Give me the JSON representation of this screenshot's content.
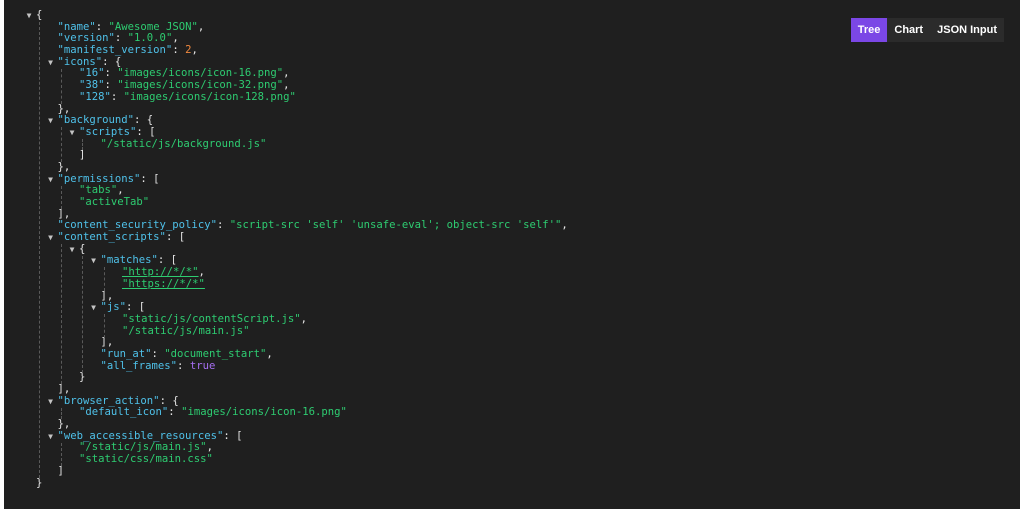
{
  "tabs": [
    {
      "label": "Tree",
      "active": true
    },
    {
      "label": "Chart",
      "active": false
    },
    {
      "label": "JSON Input",
      "active": false
    }
  ],
  "lines": [
    {
      "d": 0,
      "t": "o",
      "parts": [
        {
          "c": "p",
          "x": "{"
        }
      ]
    },
    {
      "d": 1,
      "parts": [
        {
          "c": "k",
          "x": "\"name\""
        },
        {
          "c": "p",
          "x": ": "
        },
        {
          "c": "s",
          "x": "\"Awesome JSON\""
        },
        {
          "c": "p",
          "x": ","
        }
      ]
    },
    {
      "d": 1,
      "parts": [
        {
          "c": "k",
          "x": "\"version\""
        },
        {
          "c": "p",
          "x": ": "
        },
        {
          "c": "s",
          "x": "\"1.0.0\""
        },
        {
          "c": "p",
          "x": ","
        }
      ]
    },
    {
      "d": 1,
      "parts": [
        {
          "c": "k",
          "x": "\"manifest_version\""
        },
        {
          "c": "p",
          "x": ": "
        },
        {
          "c": "n",
          "x": "2"
        },
        {
          "c": "p",
          "x": ","
        }
      ]
    },
    {
      "d": 1,
      "t": "o",
      "parts": [
        {
          "c": "k",
          "x": "\"icons\""
        },
        {
          "c": "p",
          "x": ": {"
        }
      ]
    },
    {
      "d": 2,
      "parts": [
        {
          "c": "k",
          "x": "\"16\""
        },
        {
          "c": "p",
          "x": ": "
        },
        {
          "c": "s",
          "x": "\"images/icons/icon-16.png\""
        },
        {
          "c": "p",
          "x": ","
        }
      ]
    },
    {
      "d": 2,
      "parts": [
        {
          "c": "k",
          "x": "\"38\""
        },
        {
          "c": "p",
          "x": ": "
        },
        {
          "c": "s",
          "x": "\"images/icons/icon-32.png\""
        },
        {
          "c": "p",
          "x": ","
        }
      ]
    },
    {
      "d": 2,
      "parts": [
        {
          "c": "k",
          "x": "\"128\""
        },
        {
          "c": "p",
          "x": ": "
        },
        {
          "c": "s",
          "x": "\"images/icons/icon-128.png\""
        }
      ]
    },
    {
      "d": 1,
      "parts": [
        {
          "c": "p",
          "x": "},"
        }
      ]
    },
    {
      "d": 1,
      "t": "o",
      "parts": [
        {
          "c": "k",
          "x": "\"background\""
        },
        {
          "c": "p",
          "x": ": {"
        }
      ]
    },
    {
      "d": 2,
      "t": "o",
      "parts": [
        {
          "c": "k",
          "x": "\"scripts\""
        },
        {
          "c": "p",
          "x": ": ["
        }
      ]
    },
    {
      "d": 3,
      "parts": [
        {
          "c": "s",
          "x": "\"/static/js/background.js\""
        }
      ]
    },
    {
      "d": 2,
      "parts": [
        {
          "c": "p",
          "x": "]"
        }
      ]
    },
    {
      "d": 1,
      "parts": [
        {
          "c": "p",
          "x": "},"
        }
      ]
    },
    {
      "d": 1,
      "t": "o",
      "parts": [
        {
          "c": "k",
          "x": "\"permissions\""
        },
        {
          "c": "p",
          "x": ": ["
        }
      ]
    },
    {
      "d": 2,
      "parts": [
        {
          "c": "s",
          "x": "\"tabs\""
        },
        {
          "c": "p",
          "x": ","
        }
      ]
    },
    {
      "d": 2,
      "parts": [
        {
          "c": "s",
          "x": "\"activeTab\""
        }
      ]
    },
    {
      "d": 1,
      "parts": [
        {
          "c": "p",
          "x": "],"
        }
      ]
    },
    {
      "d": 1,
      "parts": [
        {
          "c": "k",
          "x": "\"content_security_policy\""
        },
        {
          "c": "p",
          "x": ": "
        },
        {
          "c": "s",
          "x": "\"script-src 'self' 'unsafe-eval'; object-src 'self'\""
        },
        {
          "c": "p",
          "x": ","
        }
      ]
    },
    {
      "d": 1,
      "t": "o",
      "parts": [
        {
          "c": "k",
          "x": "\"content_scripts\""
        },
        {
          "c": "p",
          "x": ": ["
        }
      ]
    },
    {
      "d": 2,
      "t": "o",
      "parts": [
        {
          "c": "p",
          "x": "{"
        }
      ]
    },
    {
      "d": 3,
      "t": "o",
      "parts": [
        {
          "c": "k",
          "x": "\"matches\""
        },
        {
          "c": "p",
          "x": ": ["
        }
      ]
    },
    {
      "d": 4,
      "parts": [
        {
          "c": "u",
          "x": "\"http://*/*\""
        },
        {
          "c": "p",
          "x": ","
        }
      ]
    },
    {
      "d": 4,
      "parts": [
        {
          "c": "u",
          "x": "\"https://*/*\""
        }
      ]
    },
    {
      "d": 3,
      "parts": [
        {
          "c": "p",
          "x": "],"
        }
      ]
    },
    {
      "d": 3,
      "t": "o",
      "parts": [
        {
          "c": "k",
          "x": "\"js\""
        },
        {
          "c": "p",
          "x": ": ["
        }
      ]
    },
    {
      "d": 4,
      "parts": [
        {
          "c": "s",
          "x": "\"static/js/contentScript.js\""
        },
        {
          "c": "p",
          "x": ","
        }
      ]
    },
    {
      "d": 4,
      "parts": [
        {
          "c": "s",
          "x": "\"/static/js/main.js\""
        }
      ]
    },
    {
      "d": 3,
      "parts": [
        {
          "c": "p",
          "x": "],"
        }
      ]
    },
    {
      "d": 3,
      "parts": [
        {
          "c": "k",
          "x": "\"run_at\""
        },
        {
          "c": "p",
          "x": ": "
        },
        {
          "c": "s",
          "x": "\"document_start\""
        },
        {
          "c": "p",
          "x": ","
        }
      ]
    },
    {
      "d": 3,
      "parts": [
        {
          "c": "k",
          "x": "\"all_frames\""
        },
        {
          "c": "p",
          "x": ": "
        },
        {
          "c": "b",
          "x": "true"
        }
      ]
    },
    {
      "d": 2,
      "parts": [
        {
          "c": "p",
          "x": "}"
        }
      ]
    },
    {
      "d": 1,
      "parts": [
        {
          "c": "p",
          "x": "],"
        }
      ]
    },
    {
      "d": 1,
      "t": "o",
      "parts": [
        {
          "c": "k",
          "x": "\"browser_action\""
        },
        {
          "c": "p",
          "x": ": {"
        }
      ]
    },
    {
      "d": 2,
      "parts": [
        {
          "c": "k",
          "x": "\"default_icon\""
        },
        {
          "c": "p",
          "x": ": "
        },
        {
          "c": "s",
          "x": "\"images/icons/icon-16.png\""
        }
      ]
    },
    {
      "d": 1,
      "parts": [
        {
          "c": "p",
          "x": "},"
        }
      ]
    },
    {
      "d": 1,
      "t": "o",
      "parts": [
        {
          "c": "k",
          "x": "\"web_accessible_resources\""
        },
        {
          "c": "p",
          "x": ": ["
        }
      ]
    },
    {
      "d": 2,
      "parts": [
        {
          "c": "s",
          "x": "\"/static/js/main.js\""
        },
        {
          "c": "p",
          "x": ","
        }
      ]
    },
    {
      "d": 2,
      "parts": [
        {
          "c": "s",
          "x": "\"static/css/main.css\""
        }
      ]
    },
    {
      "d": 1,
      "parts": [
        {
          "c": "p",
          "x": "]"
        }
      ]
    },
    {
      "d": 0,
      "parts": [
        {
          "c": "p",
          "x": "}"
        }
      ]
    }
  ],
  "colors": {
    "background": "#1f1f1f",
    "key": "#4fc1e9",
    "string": "#2ecc71",
    "number": "#f0883e",
    "boolean": "#a66ff2",
    "punctuation": "#e6e6e6",
    "active_tab": "#7b47e6",
    "inactive_tab": "#2b2b2b"
  },
  "icons": {
    "expanded_toggle": "caret-down-icon"
  }
}
